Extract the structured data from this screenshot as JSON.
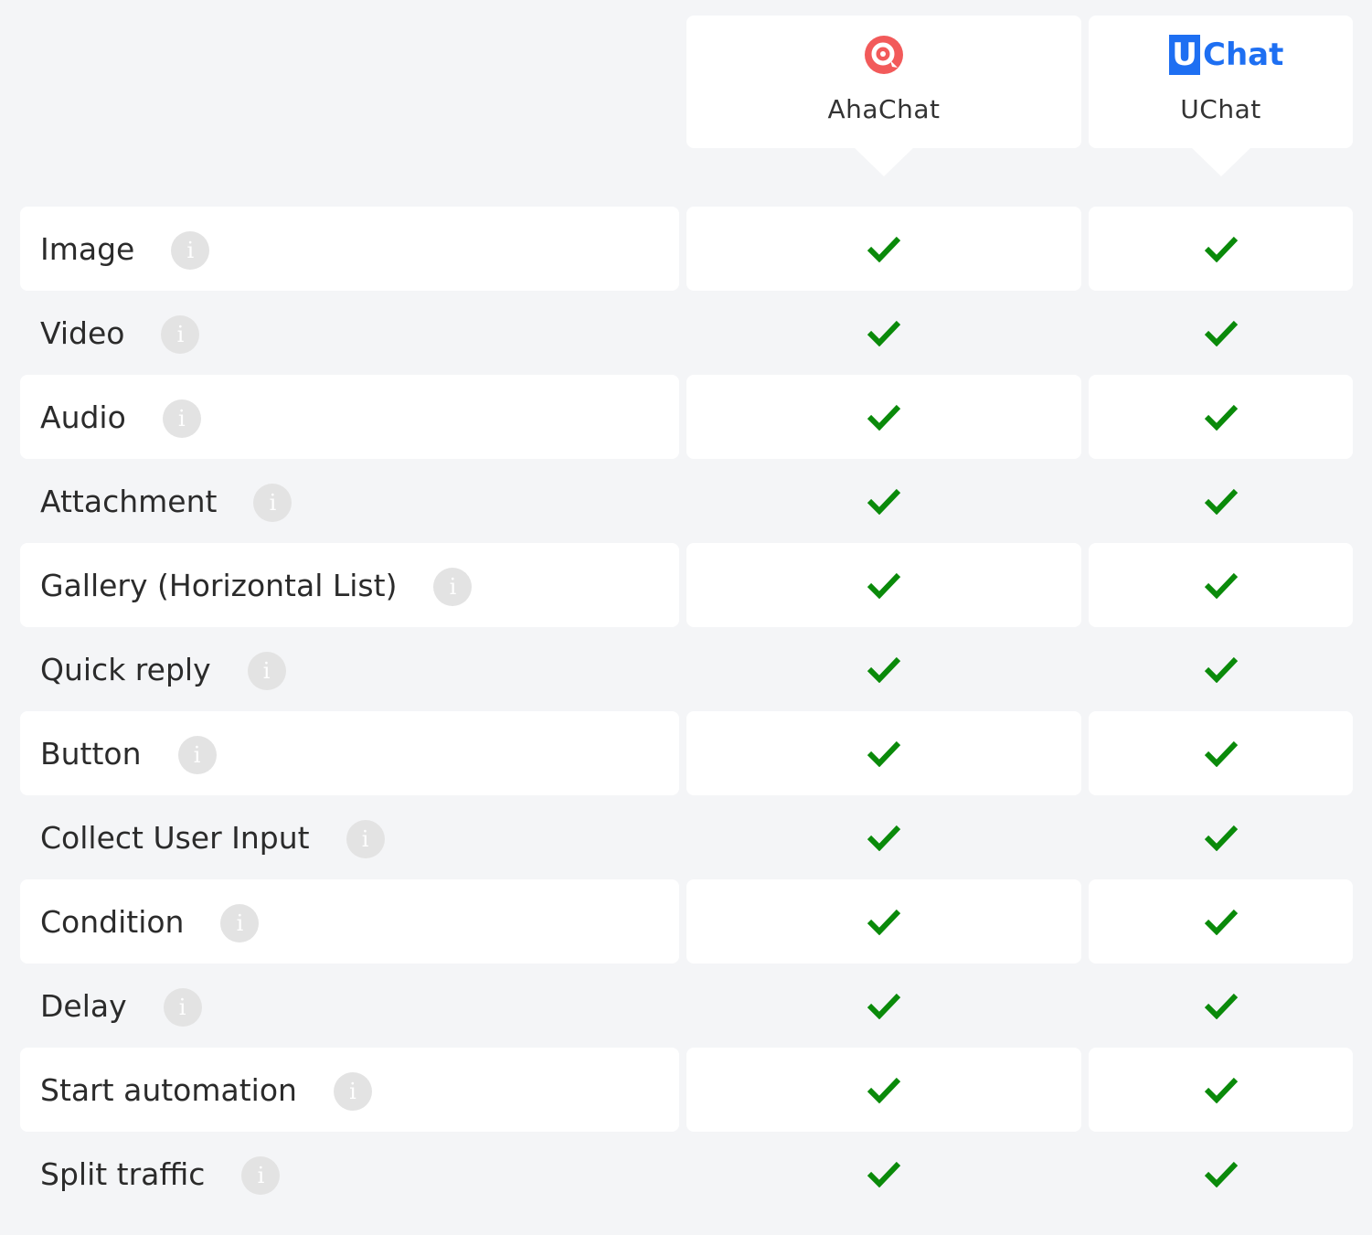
{
  "products": [
    {
      "name": "AhaChat",
      "logo": "ahachat-logo"
    },
    {
      "name": "UChat",
      "logo": "uchat-logo",
      "logo_text": "Chat",
      "logo_letter": "U"
    }
  ],
  "colors": {
    "check": "#0a8a0a",
    "uchat_brand": "#1e6ff2",
    "ahachat_brand": "#f25a5a",
    "info_icon": "#e3e3e3"
  },
  "info_icon_glyph": "i",
  "features": [
    {
      "label": "Image",
      "ahachat": true,
      "uchat": true
    },
    {
      "label": "Video",
      "ahachat": true,
      "uchat": true
    },
    {
      "label": "Audio",
      "ahachat": true,
      "uchat": true
    },
    {
      "label": "Attachment",
      "ahachat": true,
      "uchat": true
    },
    {
      "label": "Gallery (Horizontal List)",
      "ahachat": true,
      "uchat": true
    },
    {
      "label": "Quick reply",
      "ahachat": true,
      "uchat": true
    },
    {
      "label": "Button",
      "ahachat": true,
      "uchat": true
    },
    {
      "label": "Collect User Input",
      "ahachat": true,
      "uchat": true
    },
    {
      "label": "Condition",
      "ahachat": true,
      "uchat": true
    },
    {
      "label": "Delay",
      "ahachat": true,
      "uchat": true
    },
    {
      "label": "Start automation",
      "ahachat": true,
      "uchat": true
    },
    {
      "label": "Split traffic",
      "ahachat": true,
      "uchat": true
    }
  ]
}
